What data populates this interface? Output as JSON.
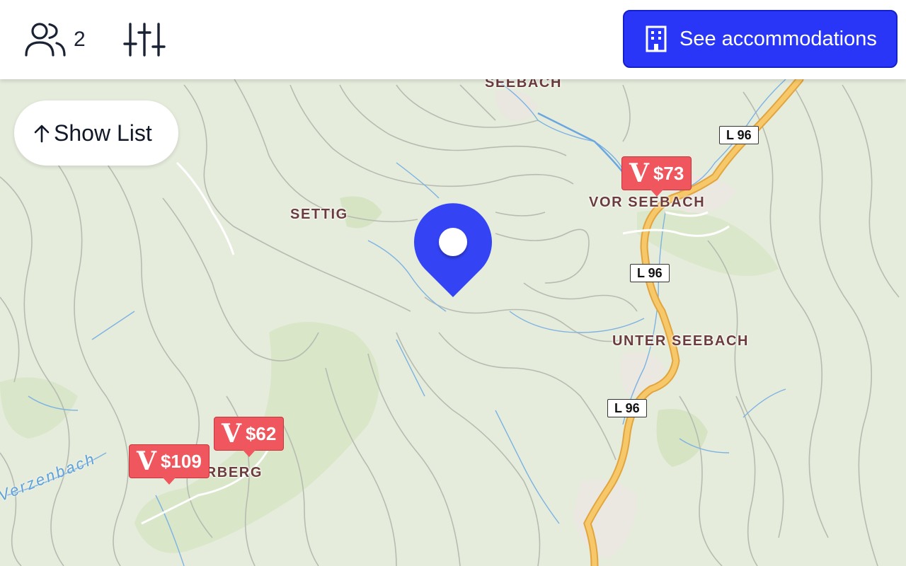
{
  "header": {
    "guests_icon": "users-icon",
    "guests_count": "2",
    "filters_icon": "sliders-icon",
    "accommodations_icon": "building-icon",
    "accommodations_label": "See accommodations",
    "accent_color": "#2a36f7"
  },
  "show_list": {
    "icon": "arrow-up-icon",
    "label": "Show List"
  },
  "map": {
    "places": {
      "seebach": "SEEBACH",
      "settig": "SETTIG",
      "vor_seebach": "VOR SEEBACH",
      "unter_seebach": "UNTER SEEBACH",
      "ferberg": "FERBERG"
    },
    "stream_label": "Verzenbach",
    "road_labels": [
      "L 96",
      "L 96",
      "L 96"
    ],
    "price_markers": [
      {
        "logo": "V",
        "price": "$73"
      },
      {
        "logo": "V",
        "price": "$62"
      },
      {
        "logo": "V",
        "price": "$109"
      }
    ],
    "selected_pin_icon": "location-pin-icon",
    "marker_color": "#f0565d"
  }
}
